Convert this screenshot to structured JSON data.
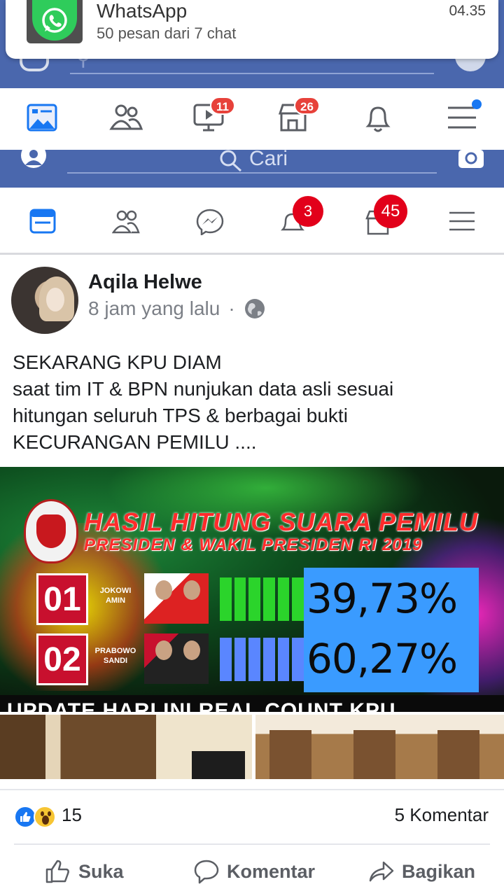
{
  "notification": {
    "app": "WhatsApp",
    "message": "50 pesan dari 7 chat",
    "time": "04.35"
  },
  "outer_nav": {
    "badges": {
      "watch": "11",
      "marketplace": "26"
    }
  },
  "inner_header": {
    "search_placeholder": "Cari"
  },
  "inner_nav": {
    "badges": {
      "notifications": "3",
      "marketplace": "45"
    }
  },
  "post": {
    "author": "Aqila Helwe",
    "time": "8 jam yang lalu",
    "separator": "·",
    "text_lines": [
      "SEKARANG KPU DIAM",
      "saat tim IT & BPN nunjukan data asli sesuai",
      "hitungan seluruh TPS & berbagai bukti",
      "KECURANGAN PEMILU ...."
    ],
    "image": {
      "headline": "HASIL HITUNG SUARA PEMILU",
      "subheadline": "PRESIDEN & WAKIL PRESIDEN RI 2019",
      "candidates": [
        {
          "number": "01",
          "name_line1": "JOKOWI",
          "name_line2": "AMIN",
          "percent": "39,73%"
        },
        {
          "number": "02",
          "name_line1": "PRABOWO",
          "name_line2": "SANDI",
          "percent": "60,27%"
        }
      ],
      "footer": "UPDATE HARI INI REAL COUNT KPU"
    },
    "reaction_count": "15",
    "comment_count": "5 Komentar",
    "actions": {
      "like": "Suka",
      "comment": "Komentar",
      "share": "Bagikan"
    }
  },
  "colors": {
    "facebook_blue": "#4a67ad",
    "badge_red": "#e7413a",
    "whatsapp_green": "#2fcc5b"
  }
}
